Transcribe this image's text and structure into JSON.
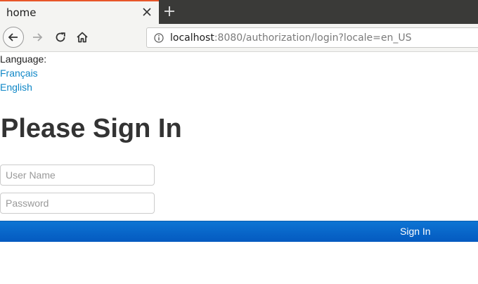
{
  "browser": {
    "tab_title": "home",
    "url_host": "localhost",
    "url_rest": ":8080/authorization/login?locale=en_US",
    "icons": [
      "close-icon",
      "plus-icon",
      "arrow-left-icon",
      "arrow-right-icon",
      "reload-icon",
      "home-icon",
      "info-icon"
    ]
  },
  "page": {
    "language_label": "Language:",
    "languages": [
      "Français",
      "English"
    ],
    "heading": "Please Sign In",
    "username_placeholder": "User Name",
    "password_placeholder": "Password",
    "signin_label": "Sign In",
    "colors": {
      "link": "#0f87c7",
      "button": "#045ac0",
      "heading": "#333333"
    }
  }
}
